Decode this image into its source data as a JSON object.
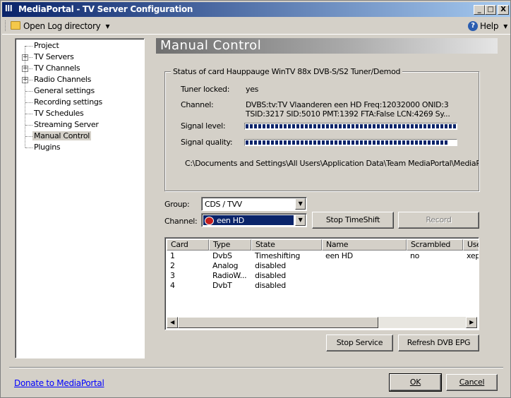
{
  "window": {
    "title": "MediaPortal - TV Server Configuration",
    "controls": {
      "minimize": "_",
      "maximize": "□",
      "close": "X"
    }
  },
  "menubar": {
    "open_log": "Open Log directory",
    "open_log_arrow": "▾",
    "help": "Help",
    "help_arrow": "▾"
  },
  "tree": {
    "items": [
      {
        "label": "Project",
        "expandable": false
      },
      {
        "label": "TV Servers",
        "expandable": true
      },
      {
        "label": "TV Channels",
        "expandable": true
      },
      {
        "label": "Radio Channels",
        "expandable": true
      },
      {
        "label": "General settings",
        "expandable": false
      },
      {
        "label": "Recording settings",
        "expandable": false
      },
      {
        "label": "TV Schedules",
        "expandable": false
      },
      {
        "label": "Streaming Server",
        "expandable": false
      },
      {
        "label": "Manual Control",
        "expandable": false,
        "selected": true
      },
      {
        "label": "Plugins",
        "expandable": false
      }
    ]
  },
  "header": {
    "title": "Manual Control"
  },
  "status": {
    "group_title": "Status of card Hauppauge WinTV 88x DVB-S/S2 Tuner/Demod",
    "tuner_locked_label": "Tuner locked:",
    "tuner_locked_value": "yes",
    "channel_label": "Channel:",
    "channel_value_line1": "DVBS:tv:TV Vlaanderen een HD  Freq:12032000 ONID:3",
    "channel_value_line2": "TSID:3217  SID:5010  PMT:1392  FTA:False  LCN:4269 Sy...",
    "signal_level_label": "Signal level:",
    "signal_level_fraction": 1.0,
    "signal_quality_label": "Signal quality:",
    "signal_quality_fraction": 0.96,
    "path": "C:\\Documents  and  Settings\\All  Users\\Application  Data\\Team  MediaPortal\\MediaPort"
  },
  "controls": {
    "group_label": "Group:",
    "group_value": "CDS / TVV",
    "channel_label": "Channel:",
    "channel_value": "een HD",
    "stop_timeshift": "Stop TimeShift",
    "record": "Record"
  },
  "table": {
    "columns": [
      "Card",
      "Type",
      "State",
      "Name",
      "Scrambled",
      "Use"
    ],
    "rows": [
      [
        "1",
        "DvbS",
        "Timeshifting",
        "een HD",
        "no",
        "xep"
      ],
      [
        "2",
        "Analog",
        "disabled",
        "",
        "",
        ""
      ],
      [
        "3",
        "RadioW...",
        "disabled",
        "",
        "",
        ""
      ],
      [
        "4",
        "DvbT",
        "disabled",
        "",
        "",
        ""
      ]
    ]
  },
  "buttons": {
    "stop_service": "Stop Service",
    "refresh_epg": "Refresh DVB EPG",
    "ok": "OK",
    "cancel": "Cancel"
  },
  "footer": {
    "donate_link": "Donate to MediaPortal"
  },
  "colors": {
    "title_start": "#0a246a",
    "title_end": "#a6caf0",
    "selection": "#0a246a",
    "link": "#0000ff"
  }
}
